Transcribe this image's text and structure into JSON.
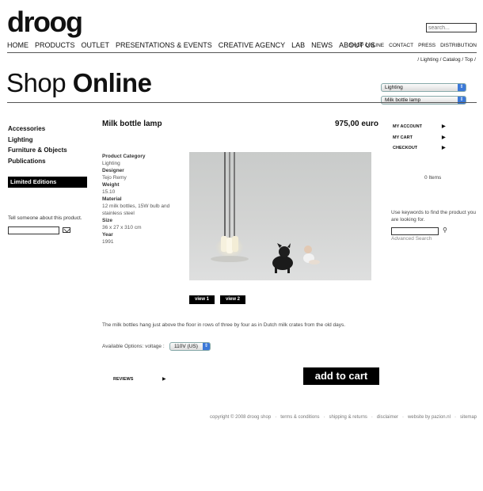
{
  "brand": {
    "logo": "droog"
  },
  "search": {
    "placeholder": "search..."
  },
  "main_nav": [
    "HOME",
    "PRODUCTS",
    "OUTLET",
    "PRESENTATIONS & EVENTS",
    "CREATIVE AGENCY",
    "LAB",
    "NEWS",
    "ABOUT US"
  ],
  "sub_nav": [
    "SHOP ONLINE",
    "CONTACT",
    "PRESS",
    "DISTRIBUTION"
  ],
  "breadcrumb": [
    "/ Lighting",
    "/ Catalog",
    "/ Top /"
  ],
  "page_title": {
    "light": "Shop ",
    "bold": "Online"
  },
  "selects": {
    "category": "Lighting",
    "product": "Milk bottle lamp"
  },
  "left_nav": {
    "items": [
      "Accessories",
      "Lighting",
      "Furniture & Objects",
      "Publications"
    ],
    "limited": "Limited Editions",
    "tell_label": "Tell someone about this product."
  },
  "product": {
    "name": "Milk bottle lamp",
    "price": "975,00 euro",
    "specs": [
      {
        "label": "Product Category",
        "value": "Lighting"
      },
      {
        "label": "Designer",
        "value": "Tejo Remy"
      },
      {
        "label": "Weight",
        "value": "15.10"
      },
      {
        "label": "Material",
        "value": "12 milk bottles, 15W bulb and stainless steel"
      },
      {
        "label": "Size",
        "value": "36 x 27 x 310 cm"
      },
      {
        "label": "Year",
        "value": "1991"
      }
    ],
    "views": [
      "view 1",
      "view 2"
    ],
    "description": "The milk bottles hang just above the floor in rows of three by four as in Dutch milk crates from the old days.",
    "options_label": "Available Options: voltage :",
    "voltage": "110V (US)",
    "reviews_label": "REVIEWS",
    "add_to_cart": "add to cart"
  },
  "account": {
    "links": [
      "MY ACCOUNT",
      "MY CART",
      "CHECKOUT"
    ],
    "items_count": "0 Items",
    "keyword_help": "Use keywords to find the product you are looking for.",
    "advanced_search": "Advanced Search"
  },
  "footer": [
    "copyright © 2008 droog shop",
    "terms & conditions",
    "shipping & returns",
    "disclaimer",
    "website by pazion.nl",
    "sitemap"
  ]
}
